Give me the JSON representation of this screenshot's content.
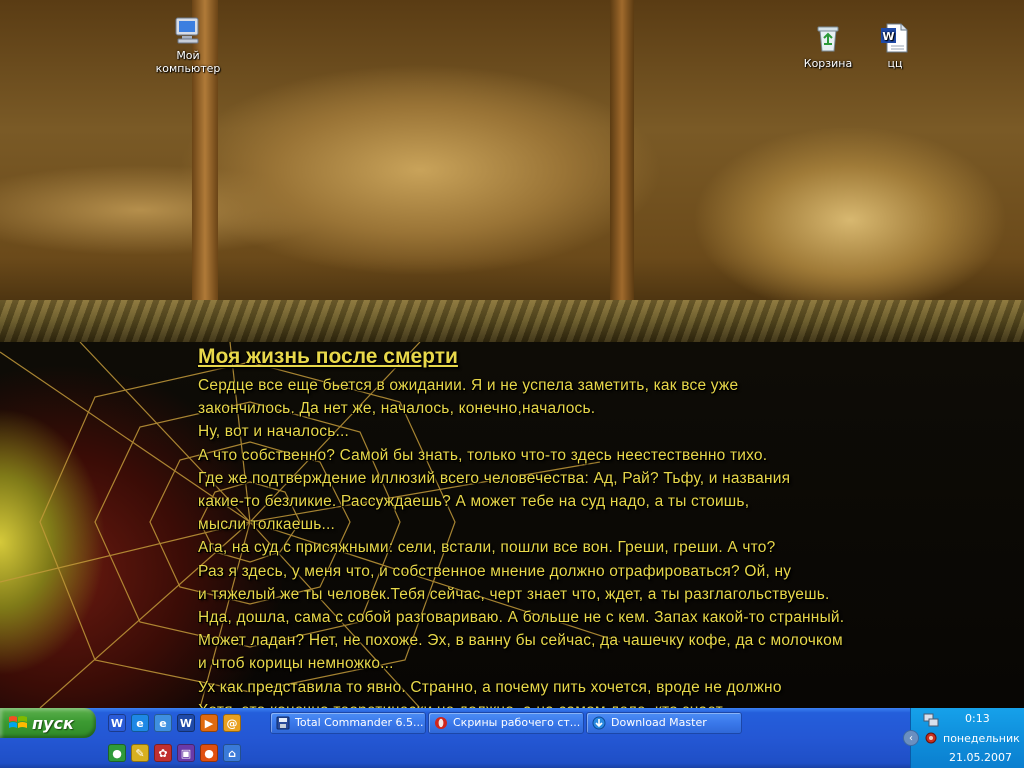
{
  "desktop": {
    "icons": [
      {
        "label": "Мой\nкомпьютер",
        "icon": "my-computer-icon"
      },
      {
        "label": "Корзина",
        "icon": "recycle-bin-icon"
      },
      {
        "label": "цц",
        "icon": "word-document-icon"
      }
    ],
    "story": {
      "title": "Моя жизнь после смерти",
      "lines": [
        "  Сердце все еще бьется в ожидании. Я и не успела заметить, как все уже",
        "закончилось. Да нет же, началось, конечно,началось.",
        "Ну, вот и началось...",
        "  А что собственно? Самой бы знать, только что-то здесь неестественно тихо.",
        "Где же подтверждение иллюзий всего человечества: Ад, Рай?  Тьфу, и названия",
        "какие-то безликие. Рассуждаешь? А может тебе на суд надо, а ты стоишь,",
        "мысли толкаешь...",
        "  Ага, на суд с присяжными: сели, встали, пошли все вон. Греши, греши. А что?",
        "Раз я здесь, у меня что, и собственное мнение должно отрафироваться? Ой, ну",
        "и тяжелый же ты человек.Тебя сейчас, черт знает что, ждет, а ты разглагольствуешь.",
        "Нда, дошла, сама с собой разговариваю. А больше не с кем. Запах какой-то странный.",
        "Может ладан? Нет, не похоже. Эх, в ванну бы сейчас, да чашечку кофе, да с молочком",
        "и чтоб корицы немножко...",
        "  Ух как представила то явно. Странно, а почему пить хочется, вроде не должно",
        "Хотя, это конечно теоретически не должно, а на самом деле, кто знает."
      ]
    }
  },
  "taskbar": {
    "start_label": "пуск",
    "quick_launch": [
      {
        "icon": "word-icon",
        "glyph": "W",
        "color": "#2a5bd7"
      },
      {
        "icon": "internet-explorer-icon",
        "glyph": "e",
        "color": "#1e88e5"
      },
      {
        "icon": "outlook-express-icon",
        "glyph": "e",
        "color": "#3f8fe0"
      },
      {
        "icon": "word-doc-icon",
        "glyph": "W",
        "color": "#1f4aa8"
      },
      {
        "icon": "media-player-icon",
        "glyph": "▶",
        "color": "#e06a10"
      },
      {
        "icon": "email-icon",
        "glyph": "@",
        "color": "#e8a020"
      },
      {
        "icon": "globe-icon",
        "glyph": "●",
        "color": "#2f9a3a"
      },
      {
        "icon": "pencil-icon",
        "glyph": "✎",
        "color": "#d8b020"
      },
      {
        "icon": "paint-icon",
        "glyph": "✿",
        "color": "#c03030"
      },
      {
        "icon": "save-disk-icon",
        "glyph": "▣",
        "color": "#6a3aa8"
      },
      {
        "icon": "orange-ball-icon",
        "glyph": "●",
        "color": "#e05010"
      },
      {
        "icon": "network-icon",
        "glyph": "⌂",
        "color": "#3a7ad8"
      }
    ],
    "tasks": [
      {
        "label": "Total Commander 6.5...",
        "icon": "disk-icon"
      },
      {
        "label": "Скрины рабочего ст...",
        "icon": "opera-icon"
      },
      {
        "label": "Download Master",
        "icon": "download-master-icon"
      }
    ],
    "tray": {
      "time": "0:13",
      "day": "понедельник",
      "date": "21.05.2007"
    }
  }
}
